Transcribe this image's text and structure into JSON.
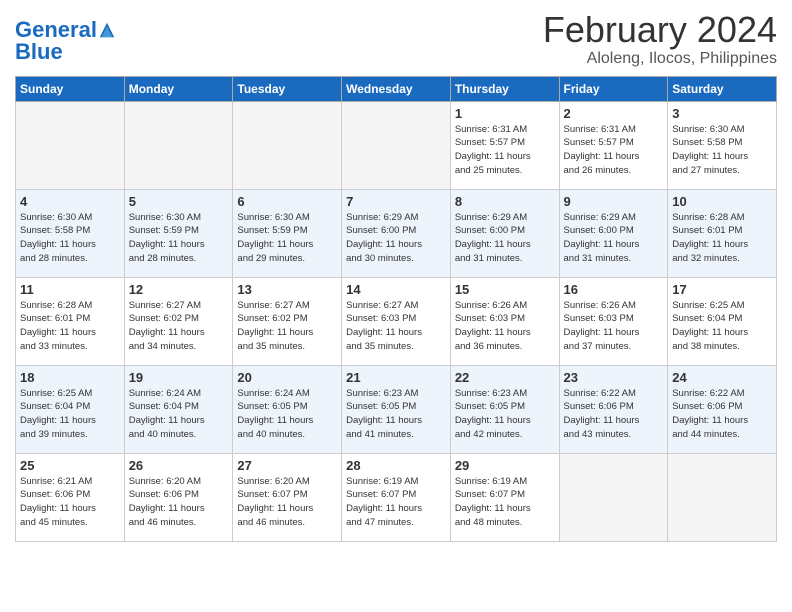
{
  "header": {
    "logo_line1": "General",
    "logo_line2": "Blue",
    "month": "February 2024",
    "location": "Aloleng, Ilocos, Philippines"
  },
  "weekdays": [
    "Sunday",
    "Monday",
    "Tuesday",
    "Wednesday",
    "Thursday",
    "Friday",
    "Saturday"
  ],
  "weeks": [
    [
      {
        "day": "",
        "info": ""
      },
      {
        "day": "",
        "info": ""
      },
      {
        "day": "",
        "info": ""
      },
      {
        "day": "",
        "info": ""
      },
      {
        "day": "1",
        "info": "Sunrise: 6:31 AM\nSunset: 5:57 PM\nDaylight: 11 hours\nand 25 minutes."
      },
      {
        "day": "2",
        "info": "Sunrise: 6:31 AM\nSunset: 5:57 PM\nDaylight: 11 hours\nand 26 minutes."
      },
      {
        "day": "3",
        "info": "Sunrise: 6:30 AM\nSunset: 5:58 PM\nDaylight: 11 hours\nand 27 minutes."
      }
    ],
    [
      {
        "day": "4",
        "info": "Sunrise: 6:30 AM\nSunset: 5:58 PM\nDaylight: 11 hours\nand 28 minutes."
      },
      {
        "day": "5",
        "info": "Sunrise: 6:30 AM\nSunset: 5:59 PM\nDaylight: 11 hours\nand 28 minutes."
      },
      {
        "day": "6",
        "info": "Sunrise: 6:30 AM\nSunset: 5:59 PM\nDaylight: 11 hours\nand 29 minutes."
      },
      {
        "day": "7",
        "info": "Sunrise: 6:29 AM\nSunset: 6:00 PM\nDaylight: 11 hours\nand 30 minutes."
      },
      {
        "day": "8",
        "info": "Sunrise: 6:29 AM\nSunset: 6:00 PM\nDaylight: 11 hours\nand 31 minutes."
      },
      {
        "day": "9",
        "info": "Sunrise: 6:29 AM\nSunset: 6:00 PM\nDaylight: 11 hours\nand 31 minutes."
      },
      {
        "day": "10",
        "info": "Sunrise: 6:28 AM\nSunset: 6:01 PM\nDaylight: 11 hours\nand 32 minutes."
      }
    ],
    [
      {
        "day": "11",
        "info": "Sunrise: 6:28 AM\nSunset: 6:01 PM\nDaylight: 11 hours\nand 33 minutes."
      },
      {
        "day": "12",
        "info": "Sunrise: 6:27 AM\nSunset: 6:02 PM\nDaylight: 11 hours\nand 34 minutes."
      },
      {
        "day": "13",
        "info": "Sunrise: 6:27 AM\nSunset: 6:02 PM\nDaylight: 11 hours\nand 35 minutes."
      },
      {
        "day": "14",
        "info": "Sunrise: 6:27 AM\nSunset: 6:03 PM\nDaylight: 11 hours\nand 35 minutes."
      },
      {
        "day": "15",
        "info": "Sunrise: 6:26 AM\nSunset: 6:03 PM\nDaylight: 11 hours\nand 36 minutes."
      },
      {
        "day": "16",
        "info": "Sunrise: 6:26 AM\nSunset: 6:03 PM\nDaylight: 11 hours\nand 37 minutes."
      },
      {
        "day": "17",
        "info": "Sunrise: 6:25 AM\nSunset: 6:04 PM\nDaylight: 11 hours\nand 38 minutes."
      }
    ],
    [
      {
        "day": "18",
        "info": "Sunrise: 6:25 AM\nSunset: 6:04 PM\nDaylight: 11 hours\nand 39 minutes."
      },
      {
        "day": "19",
        "info": "Sunrise: 6:24 AM\nSunset: 6:04 PM\nDaylight: 11 hours\nand 40 minutes."
      },
      {
        "day": "20",
        "info": "Sunrise: 6:24 AM\nSunset: 6:05 PM\nDaylight: 11 hours\nand 40 minutes."
      },
      {
        "day": "21",
        "info": "Sunrise: 6:23 AM\nSunset: 6:05 PM\nDaylight: 11 hours\nand 41 minutes."
      },
      {
        "day": "22",
        "info": "Sunrise: 6:23 AM\nSunset: 6:05 PM\nDaylight: 11 hours\nand 42 minutes."
      },
      {
        "day": "23",
        "info": "Sunrise: 6:22 AM\nSunset: 6:06 PM\nDaylight: 11 hours\nand 43 minutes."
      },
      {
        "day": "24",
        "info": "Sunrise: 6:22 AM\nSunset: 6:06 PM\nDaylight: 11 hours\nand 44 minutes."
      }
    ],
    [
      {
        "day": "25",
        "info": "Sunrise: 6:21 AM\nSunset: 6:06 PM\nDaylight: 11 hours\nand 45 minutes."
      },
      {
        "day": "26",
        "info": "Sunrise: 6:20 AM\nSunset: 6:06 PM\nDaylight: 11 hours\nand 46 minutes."
      },
      {
        "day": "27",
        "info": "Sunrise: 6:20 AM\nSunset: 6:07 PM\nDaylight: 11 hours\nand 46 minutes."
      },
      {
        "day": "28",
        "info": "Sunrise: 6:19 AM\nSunset: 6:07 PM\nDaylight: 11 hours\nand 47 minutes."
      },
      {
        "day": "29",
        "info": "Sunrise: 6:19 AM\nSunset: 6:07 PM\nDaylight: 11 hours\nand 48 minutes."
      },
      {
        "day": "",
        "info": ""
      },
      {
        "day": "",
        "info": ""
      }
    ]
  ]
}
